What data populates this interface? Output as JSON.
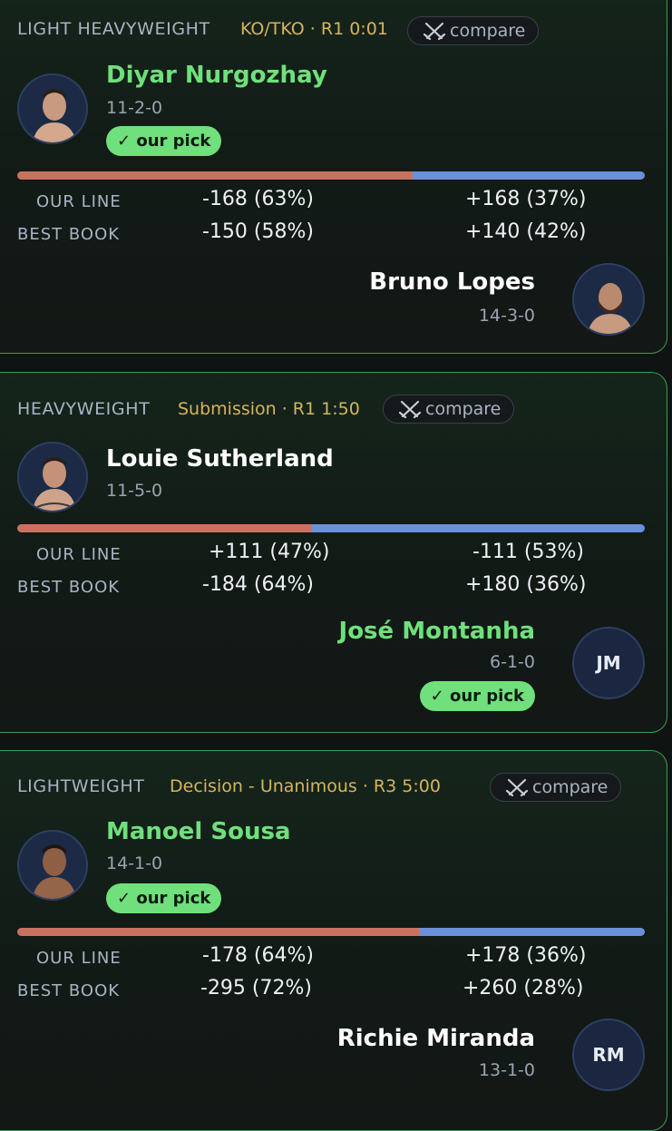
{
  "colors": {
    "accent_green": "#6fe07b",
    "method_gold": "#d6b45c",
    "bar_red": "#c9715f",
    "bar_blue": "#6a8fdb"
  },
  "bouts": [
    {
      "weight_class": "LIGHT HEAVYWEIGHT",
      "method": "KO/TKO · R1 0:01",
      "compare_label": "compare",
      "compare_icon": "crossed-swords-icon",
      "fighter1": {
        "name": "Diyar Nurgozhay",
        "record": "11-2-0",
        "pick": true,
        "pick_label": "✓ our pick",
        "avatar": "photo"
      },
      "fighter2": {
        "name": "Bruno Lopes",
        "record": "14-3-0",
        "pick": false,
        "avatar": "photo"
      },
      "bar_red_fraction": 0.63,
      "our_line_label": "OUR LINE",
      "best_book_label": "BEST BOOK",
      "our_line": {
        "f1": "-168 (63%)",
        "f2": "+168 (37%)"
      },
      "best_book": {
        "f1": "-150 (58%)",
        "f2": "+140 (42%)"
      }
    },
    {
      "weight_class": "HEAVYWEIGHT",
      "method": "Submission · R1 1:50",
      "compare_label": "compare",
      "compare_icon": "crossed-swords-icon",
      "fighter1": {
        "name": "Louie Sutherland",
        "record": "11-5-0",
        "pick": false,
        "avatar": "photo"
      },
      "fighter2": {
        "name": "José Montanha",
        "record": "6-1-0",
        "pick": true,
        "pick_label": "✓ our pick",
        "avatar": "initials",
        "initials": "JM"
      },
      "bar_red_fraction": 0.47,
      "our_line_label": "OUR LINE",
      "best_book_label": "BEST BOOK",
      "our_line": {
        "f1": "+111 (47%)",
        "f2": "-111 (53%)"
      },
      "best_book": {
        "f1": "-184 (64%)",
        "f2": "+180 (36%)"
      }
    },
    {
      "weight_class": "LIGHTWEIGHT",
      "method": "Decision - Unanimous · R3 5:00",
      "compare_label": "compare",
      "compare_icon": "crossed-swords-icon",
      "fighter1": {
        "name": "Manoel Sousa",
        "record": "14-1-0",
        "pick": true,
        "pick_label": "✓ our pick",
        "avatar": "photo"
      },
      "fighter2": {
        "name": "Richie Miranda",
        "record": "13-1-0",
        "pick": false,
        "avatar": "initials",
        "initials": "RM"
      },
      "bar_red_fraction": 0.64,
      "our_line_label": "OUR LINE",
      "best_book_label": "BEST BOOK",
      "our_line": {
        "f1": "-178 (64%)",
        "f2": "+178 (36%)"
      },
      "best_book": {
        "f1": "-295 (72%)",
        "f2": "+260 (28%)"
      }
    }
  ]
}
